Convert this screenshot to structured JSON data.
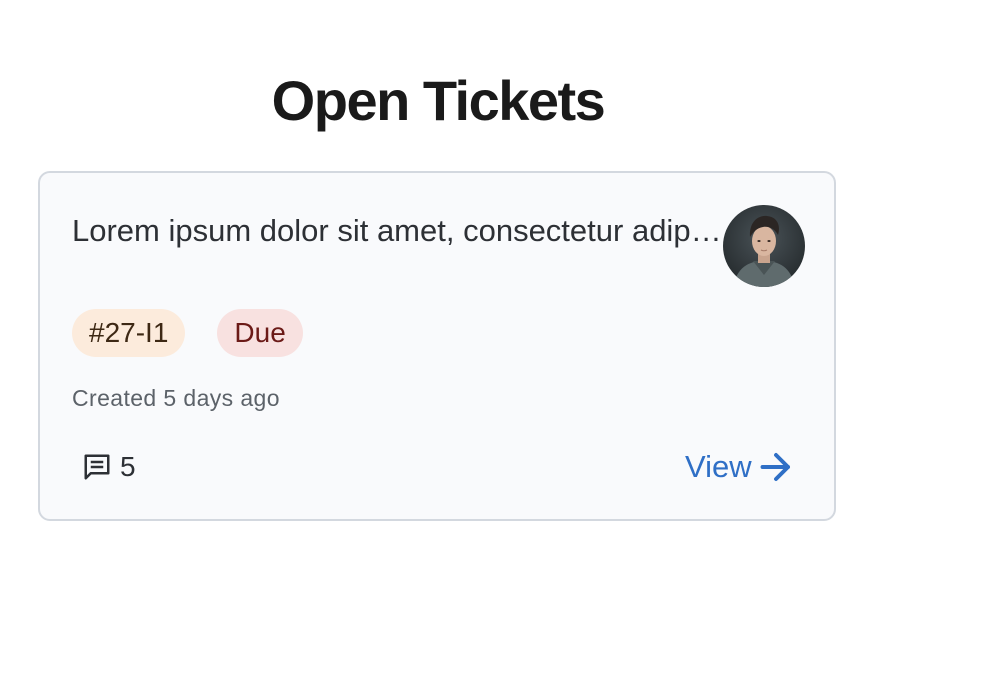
{
  "page": {
    "title": "Open Tickets"
  },
  "ticket": {
    "summary": "Lorem ipsum dolor sit amet, consectetur adipiscing elit",
    "id_tag": "#27-I1",
    "status_tag": "Due",
    "created": "Created 5 days ago",
    "comment_count": "5",
    "view_label": "View",
    "avatar_icon": "user-avatar-photo",
    "comment_icon": "comment-icon",
    "arrow_icon": "arrow-right-icon"
  },
  "colors": {
    "accent_link": "#2f6fc6",
    "id_tag_bg": "#fcebdc",
    "status_tag_bg": "#f8e1e0",
    "card_bg": "#f9fafc",
    "card_border": "#d3d8df"
  }
}
